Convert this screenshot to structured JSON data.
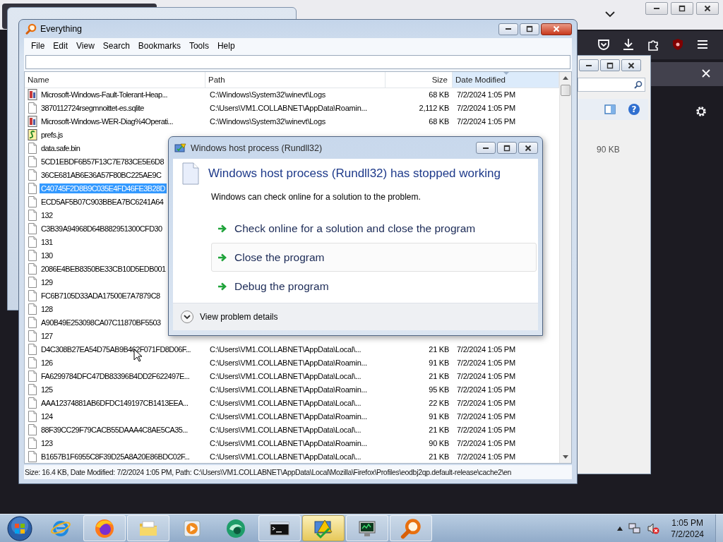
{
  "side_window": {
    "help_glyph": "?",
    "size_cell": "90 KB"
  },
  "everything_window": {
    "title": "Everything",
    "menu": [
      "File",
      "Edit",
      "View",
      "Search",
      "Bookmarks",
      "Tools",
      "Help"
    ],
    "columns": [
      {
        "label": "Name",
        "sorted": false
      },
      {
        "label": "Path",
        "sorted": false
      },
      {
        "label": "Size",
        "sorted": false
      },
      {
        "label": "Date Modified",
        "sorted": true
      }
    ],
    "rows": [
      {
        "kind": "log",
        "name": "Microsoft-Windows-Fault-Tolerant-Heap...",
        "path": "C:\\Windows\\System32\\winevt\\Logs",
        "size": "68 KB",
        "date": "7/2/2024 1:05 PM",
        "selected": false
      },
      {
        "kind": "file",
        "name": "3870112724rsegmnoittet-es.sqlite",
        "path": "C:\\Users\\VM1.COLLABNET\\AppData\\Roamin...",
        "size": "2,112 KB",
        "date": "7/2/2024 1:05 PM",
        "selected": false
      },
      {
        "kind": "log",
        "name": "Microsoft-Windows-WER-Diag%4Operati...",
        "path": "C:\\Windows\\System32\\winevt\\Logs",
        "size": "68 KB",
        "date": "7/2/2024 1:05 PM",
        "selected": false
      },
      {
        "kind": "script",
        "name": "prefs.js",
        "selected": false
      },
      {
        "kind": "file",
        "name": "data.safe.bin",
        "selected": false
      },
      {
        "kind": "file",
        "name": "5CD1EBDF6B57F13C7E783CE5E6D8",
        "selected": false
      },
      {
        "kind": "file",
        "name": "36CE681AB6E36A57F80BC225AE9C",
        "selected": false
      },
      {
        "kind": "file",
        "name": "C40745F2D8B9C035E4FD46FE3B28D",
        "selected": true
      },
      {
        "kind": "file",
        "name": "ECD5AF5B07C903BBEA7BC6241A64",
        "selected": false
      },
      {
        "kind": "file",
        "name": "132",
        "selected": false
      },
      {
        "kind": "file",
        "name": "C3B39A94968D64B882951300CFD30",
        "selected": false
      },
      {
        "kind": "file",
        "name": "131",
        "selected": false
      },
      {
        "kind": "file",
        "name": "130",
        "selected": false
      },
      {
        "kind": "file",
        "name": "2086E4BEB8350BE33CB10D5EDB001",
        "selected": false
      },
      {
        "kind": "file",
        "name": "129",
        "selected": false
      },
      {
        "kind": "file",
        "name": "FC6B7105D33ADA17500E7A7879C8",
        "selected": false
      },
      {
        "kind": "file",
        "name": "128",
        "selected": false
      },
      {
        "kind": "file",
        "name": "A90B49E253098CA07C11870BF5503",
        "selected": false
      },
      {
        "kind": "file",
        "name": "127",
        "selected": false
      },
      {
        "kind": "file",
        "name": "D4C308B27EA54D75AB9B462F071FD8D06F...",
        "path": "C:\\Users\\VM1.COLLABNET\\AppData\\Local\\...",
        "size": "21 KB",
        "date": "7/2/2024 1:05 PM",
        "selected": false
      },
      {
        "kind": "file",
        "name": "126",
        "path": "C:\\Users\\VM1.COLLABNET\\AppData\\Roamin...",
        "size": "91 KB",
        "date": "7/2/2024 1:05 PM",
        "selected": false
      },
      {
        "kind": "file",
        "name": "FA6299784DFC47DB83396B4DD2F622497E...",
        "path": "C:\\Users\\VM1.COLLABNET\\AppData\\Local\\...",
        "size": "21 KB",
        "date": "7/2/2024 1:05 PM",
        "selected": false
      },
      {
        "kind": "file",
        "name": "125",
        "path": "C:\\Users\\VM1.COLLABNET\\AppData\\Roamin...",
        "size": "95 KB",
        "date": "7/2/2024 1:05 PM",
        "selected": false
      },
      {
        "kind": "file",
        "name": "AAA12374881AB6DFDC149197CB1413EEA...",
        "path": "C:\\Users\\VM1.COLLABNET\\AppData\\Local\\...",
        "size": "22 KB",
        "date": "7/2/2024 1:05 PM",
        "selected": false
      },
      {
        "kind": "file",
        "name": "124",
        "path": "C:\\Users\\VM1.COLLABNET\\AppData\\Roamin...",
        "size": "91 KB",
        "date": "7/2/2024 1:05 PM",
        "selected": false
      },
      {
        "kind": "file",
        "name": "88F39CC29F79CACB55DAAA4C8AE5CA35...",
        "path": "C:\\Users\\VM1.COLLABNET\\AppData\\Local\\...",
        "size": "21 KB",
        "date": "7/2/2024 1:05 PM",
        "selected": false
      },
      {
        "kind": "file",
        "name": "123",
        "path": "C:\\Users\\VM1.COLLABNET\\AppData\\Roamin...",
        "size": "90 KB",
        "date": "7/2/2024 1:05 PM",
        "selected": false
      },
      {
        "kind": "file",
        "name": "B1657B1F6955C8F39D25A8A20E86BDC02F...",
        "path": "C:\\Users\\VM1.COLLABNET\\AppData\\Local\\...",
        "size": "21 KB",
        "date": "7/2/2024 1:05 PM",
        "selected": false
      }
    ],
    "status_bar": "Size: 16.4 KB, Date Modified: 7/2/2024 1:05 PM, Path: C:\\Users\\VM1.COLLABNET\\AppData\\Local\\Mozilla\\Firefox\\Profiles\\eodbj2qp.default-release\\cache2\\en"
  },
  "error_dialog": {
    "title": "Windows host process (Rundll32)",
    "heading": "Windows host process (Rundll32) has stopped working",
    "message": "Windows can check online for a solution to the problem.",
    "options": [
      {
        "label": "Check online for a solution and close the program",
        "selected": false
      },
      {
        "label": "Close the program",
        "selected": true
      },
      {
        "label": "Debug the program",
        "selected": false
      }
    ],
    "details_toggle": {
      "label": "View problem details",
      "expanded": false
    }
  },
  "taskbar": {
    "items": [
      {
        "kind": "ie",
        "open": false,
        "highlighted": false
      },
      {
        "kind": "firefox",
        "open": true,
        "highlighted": false
      },
      {
        "kind": "explorer",
        "open": true,
        "highlighted": false
      },
      {
        "kind": "media",
        "open": false,
        "highlighted": false
      },
      {
        "kind": "green",
        "open": false,
        "highlighted": false
      },
      {
        "kind": "cmd",
        "open": true,
        "highlighted": false
      },
      {
        "kind": "warning",
        "open": true,
        "highlighted": true
      },
      {
        "kind": "network",
        "open": true,
        "highlighted": false
      },
      {
        "kind": "everything",
        "open": true,
        "highlighted": false
      }
    ],
    "clock": {
      "time": "1:05 PM",
      "date": "7/2/2024"
    }
  }
}
